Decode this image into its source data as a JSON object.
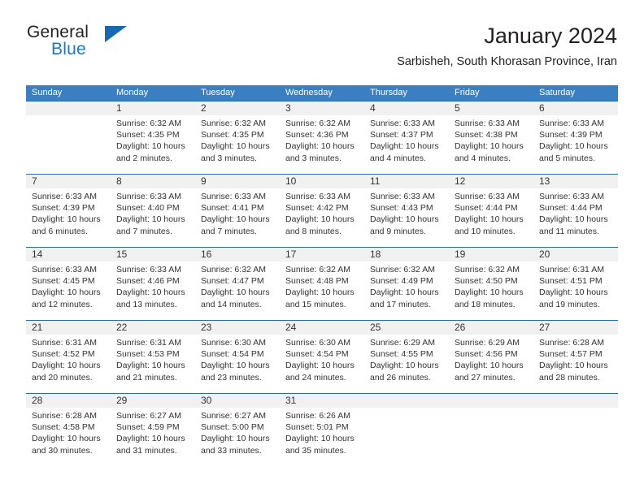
{
  "brand": {
    "name_part1": "General",
    "name_part2": "Blue",
    "triangle_color": "#1668b0"
  },
  "header": {
    "title": "January 2024",
    "subtitle": "Sarbisheh, South Khorasan Province, Iran"
  },
  "theme": {
    "header_bg": "#3a7fc1",
    "header_text": "#ffffff",
    "daynum_band": "#f1f1f1",
    "week_divider": "#2b6ca8",
    "body_text": "#333333"
  },
  "weekdays": [
    "Sunday",
    "Monday",
    "Tuesday",
    "Wednesday",
    "Thursday",
    "Friday",
    "Saturday"
  ],
  "weeks": [
    {
      "days": [
        {
          "num": "",
          "sunrise": "",
          "sunset": "",
          "daylight_1": "",
          "daylight_2": ""
        },
        {
          "num": "1",
          "sunrise": "Sunrise: 6:32 AM",
          "sunset": "Sunset: 4:35 PM",
          "daylight_1": "Daylight: 10 hours",
          "daylight_2": "and 2 minutes."
        },
        {
          "num": "2",
          "sunrise": "Sunrise: 6:32 AM",
          "sunset": "Sunset: 4:35 PM",
          "daylight_1": "Daylight: 10 hours",
          "daylight_2": "and 3 minutes."
        },
        {
          "num": "3",
          "sunrise": "Sunrise: 6:32 AM",
          "sunset": "Sunset: 4:36 PM",
          "daylight_1": "Daylight: 10 hours",
          "daylight_2": "and 3 minutes."
        },
        {
          "num": "4",
          "sunrise": "Sunrise: 6:33 AM",
          "sunset": "Sunset: 4:37 PM",
          "daylight_1": "Daylight: 10 hours",
          "daylight_2": "and 4 minutes."
        },
        {
          "num": "5",
          "sunrise": "Sunrise: 6:33 AM",
          "sunset": "Sunset: 4:38 PM",
          "daylight_1": "Daylight: 10 hours",
          "daylight_2": "and 4 minutes."
        },
        {
          "num": "6",
          "sunrise": "Sunrise: 6:33 AM",
          "sunset": "Sunset: 4:39 PM",
          "daylight_1": "Daylight: 10 hours",
          "daylight_2": "and 5 minutes."
        }
      ]
    },
    {
      "days": [
        {
          "num": "7",
          "sunrise": "Sunrise: 6:33 AM",
          "sunset": "Sunset: 4:39 PM",
          "daylight_1": "Daylight: 10 hours",
          "daylight_2": "and 6 minutes."
        },
        {
          "num": "8",
          "sunrise": "Sunrise: 6:33 AM",
          "sunset": "Sunset: 4:40 PM",
          "daylight_1": "Daylight: 10 hours",
          "daylight_2": "and 7 minutes."
        },
        {
          "num": "9",
          "sunrise": "Sunrise: 6:33 AM",
          "sunset": "Sunset: 4:41 PM",
          "daylight_1": "Daylight: 10 hours",
          "daylight_2": "and 7 minutes."
        },
        {
          "num": "10",
          "sunrise": "Sunrise: 6:33 AM",
          "sunset": "Sunset: 4:42 PM",
          "daylight_1": "Daylight: 10 hours",
          "daylight_2": "and 8 minutes."
        },
        {
          "num": "11",
          "sunrise": "Sunrise: 6:33 AM",
          "sunset": "Sunset: 4:43 PM",
          "daylight_1": "Daylight: 10 hours",
          "daylight_2": "and 9 minutes."
        },
        {
          "num": "12",
          "sunrise": "Sunrise: 6:33 AM",
          "sunset": "Sunset: 4:44 PM",
          "daylight_1": "Daylight: 10 hours",
          "daylight_2": "and 10 minutes."
        },
        {
          "num": "13",
          "sunrise": "Sunrise: 6:33 AM",
          "sunset": "Sunset: 4:44 PM",
          "daylight_1": "Daylight: 10 hours",
          "daylight_2": "and 11 minutes."
        }
      ]
    },
    {
      "days": [
        {
          "num": "14",
          "sunrise": "Sunrise: 6:33 AM",
          "sunset": "Sunset: 4:45 PM",
          "daylight_1": "Daylight: 10 hours",
          "daylight_2": "and 12 minutes."
        },
        {
          "num": "15",
          "sunrise": "Sunrise: 6:33 AM",
          "sunset": "Sunset: 4:46 PM",
          "daylight_1": "Daylight: 10 hours",
          "daylight_2": "and 13 minutes."
        },
        {
          "num": "16",
          "sunrise": "Sunrise: 6:32 AM",
          "sunset": "Sunset: 4:47 PM",
          "daylight_1": "Daylight: 10 hours",
          "daylight_2": "and 14 minutes."
        },
        {
          "num": "17",
          "sunrise": "Sunrise: 6:32 AM",
          "sunset": "Sunset: 4:48 PM",
          "daylight_1": "Daylight: 10 hours",
          "daylight_2": "and 15 minutes."
        },
        {
          "num": "18",
          "sunrise": "Sunrise: 6:32 AM",
          "sunset": "Sunset: 4:49 PM",
          "daylight_1": "Daylight: 10 hours",
          "daylight_2": "and 17 minutes."
        },
        {
          "num": "19",
          "sunrise": "Sunrise: 6:32 AM",
          "sunset": "Sunset: 4:50 PM",
          "daylight_1": "Daylight: 10 hours",
          "daylight_2": "and 18 minutes."
        },
        {
          "num": "20",
          "sunrise": "Sunrise: 6:31 AM",
          "sunset": "Sunset: 4:51 PM",
          "daylight_1": "Daylight: 10 hours",
          "daylight_2": "and 19 minutes."
        }
      ]
    },
    {
      "days": [
        {
          "num": "21",
          "sunrise": "Sunrise: 6:31 AM",
          "sunset": "Sunset: 4:52 PM",
          "daylight_1": "Daylight: 10 hours",
          "daylight_2": "and 20 minutes."
        },
        {
          "num": "22",
          "sunrise": "Sunrise: 6:31 AM",
          "sunset": "Sunset: 4:53 PM",
          "daylight_1": "Daylight: 10 hours",
          "daylight_2": "and 21 minutes."
        },
        {
          "num": "23",
          "sunrise": "Sunrise: 6:30 AM",
          "sunset": "Sunset: 4:54 PM",
          "daylight_1": "Daylight: 10 hours",
          "daylight_2": "and 23 minutes."
        },
        {
          "num": "24",
          "sunrise": "Sunrise: 6:30 AM",
          "sunset": "Sunset: 4:54 PM",
          "daylight_1": "Daylight: 10 hours",
          "daylight_2": "and 24 minutes."
        },
        {
          "num": "25",
          "sunrise": "Sunrise: 6:29 AM",
          "sunset": "Sunset: 4:55 PM",
          "daylight_1": "Daylight: 10 hours",
          "daylight_2": "and 26 minutes."
        },
        {
          "num": "26",
          "sunrise": "Sunrise: 6:29 AM",
          "sunset": "Sunset: 4:56 PM",
          "daylight_1": "Daylight: 10 hours",
          "daylight_2": "and 27 minutes."
        },
        {
          "num": "27",
          "sunrise": "Sunrise: 6:28 AM",
          "sunset": "Sunset: 4:57 PM",
          "daylight_1": "Daylight: 10 hours",
          "daylight_2": "and 28 minutes."
        }
      ]
    },
    {
      "days": [
        {
          "num": "28",
          "sunrise": "Sunrise: 6:28 AM",
          "sunset": "Sunset: 4:58 PM",
          "daylight_1": "Daylight: 10 hours",
          "daylight_2": "and 30 minutes."
        },
        {
          "num": "29",
          "sunrise": "Sunrise: 6:27 AM",
          "sunset": "Sunset: 4:59 PM",
          "daylight_1": "Daylight: 10 hours",
          "daylight_2": "and 31 minutes."
        },
        {
          "num": "30",
          "sunrise": "Sunrise: 6:27 AM",
          "sunset": "Sunset: 5:00 PM",
          "daylight_1": "Daylight: 10 hours",
          "daylight_2": "and 33 minutes."
        },
        {
          "num": "31",
          "sunrise": "Sunrise: 6:26 AM",
          "sunset": "Sunset: 5:01 PM",
          "daylight_1": "Daylight: 10 hours",
          "daylight_2": "and 35 minutes."
        },
        {
          "num": "",
          "sunrise": "",
          "sunset": "",
          "daylight_1": "",
          "daylight_2": ""
        },
        {
          "num": "",
          "sunrise": "",
          "sunset": "",
          "daylight_1": "",
          "daylight_2": ""
        },
        {
          "num": "",
          "sunrise": "",
          "sunset": "",
          "daylight_1": "",
          "daylight_2": ""
        }
      ]
    }
  ]
}
